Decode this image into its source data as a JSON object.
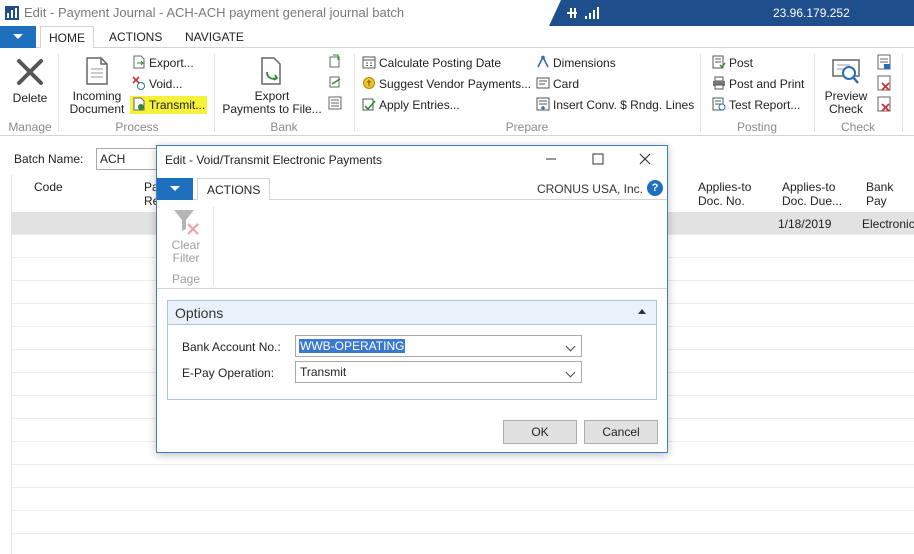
{
  "window": {
    "title": "Edit - Payment Journal - ACH-ACH payment general journal batch",
    "remote_ip": "23.96.179.252"
  },
  "ribbon": {
    "tabs": [
      "HOME",
      "ACTIONS",
      "NAVIGATE"
    ],
    "active_tab": "HOME",
    "groups": {
      "manage": {
        "label": "Manage",
        "delete": "Delete"
      },
      "process": {
        "label": "Process",
        "incoming_document": [
          "Incoming",
          "Document"
        ],
        "export": "Export...",
        "void": "Void...",
        "transmit": "Transmit..."
      },
      "bank": {
        "label": "Bank",
        "export_payments": [
          "Export",
          "Payments to File..."
        ]
      },
      "prepare": {
        "label": "Prepare",
        "calculate_posting_date": "Calculate Posting Date",
        "suggest_vendor_payments": "Suggest Vendor Payments...",
        "apply_entries": "Apply Entries...",
        "dimensions": "Dimensions",
        "card": "Card",
        "insert_conv": "Insert Conv. $ Rndg. Lines"
      },
      "posting": {
        "label": "Posting",
        "post": "Post",
        "post_and_print": "Post and Print",
        "test_report": "Test Report..."
      },
      "check": {
        "label": "Check",
        "preview_check": [
          "Preview",
          "Check"
        ]
      }
    }
  },
  "batch": {
    "label": "Batch Name:",
    "value": "ACH"
  },
  "grid": {
    "columns": {
      "code": "Code",
      "pa": [
        "Pa",
        "Re"
      ],
      "applies_to_doc_no": [
        "Applies-to",
        "Doc. No."
      ],
      "applies_to_doc_due": [
        "Applies-to",
        "Doc. Due..."
      ],
      "bank_pay": "Bank Pay"
    },
    "selected_row": {
      "due_date": "1/18/2019",
      "bank_pay": "Electronic"
    }
  },
  "dialog": {
    "title": "Edit - Void/Transmit Electronic Payments",
    "tab": "ACTIONS",
    "company": "CRONUS USA, Inc.",
    "help": "?",
    "clear_filter": [
      "Clear",
      "Filter"
    ],
    "page_group": "Page",
    "options": {
      "header": "Options",
      "bank_account_label": "Bank Account No.:",
      "bank_account_value": "WWB-OPERATING",
      "epay_label": "E-Pay Operation:",
      "epay_value": "Transmit"
    },
    "ok": "OK",
    "cancel": "Cancel"
  },
  "colors": {
    "accent": "#1f6fbf",
    "remote_bar": "#1f4e8c",
    "highlight": "#f6f13a",
    "selected_row": "#e2e2e2"
  }
}
